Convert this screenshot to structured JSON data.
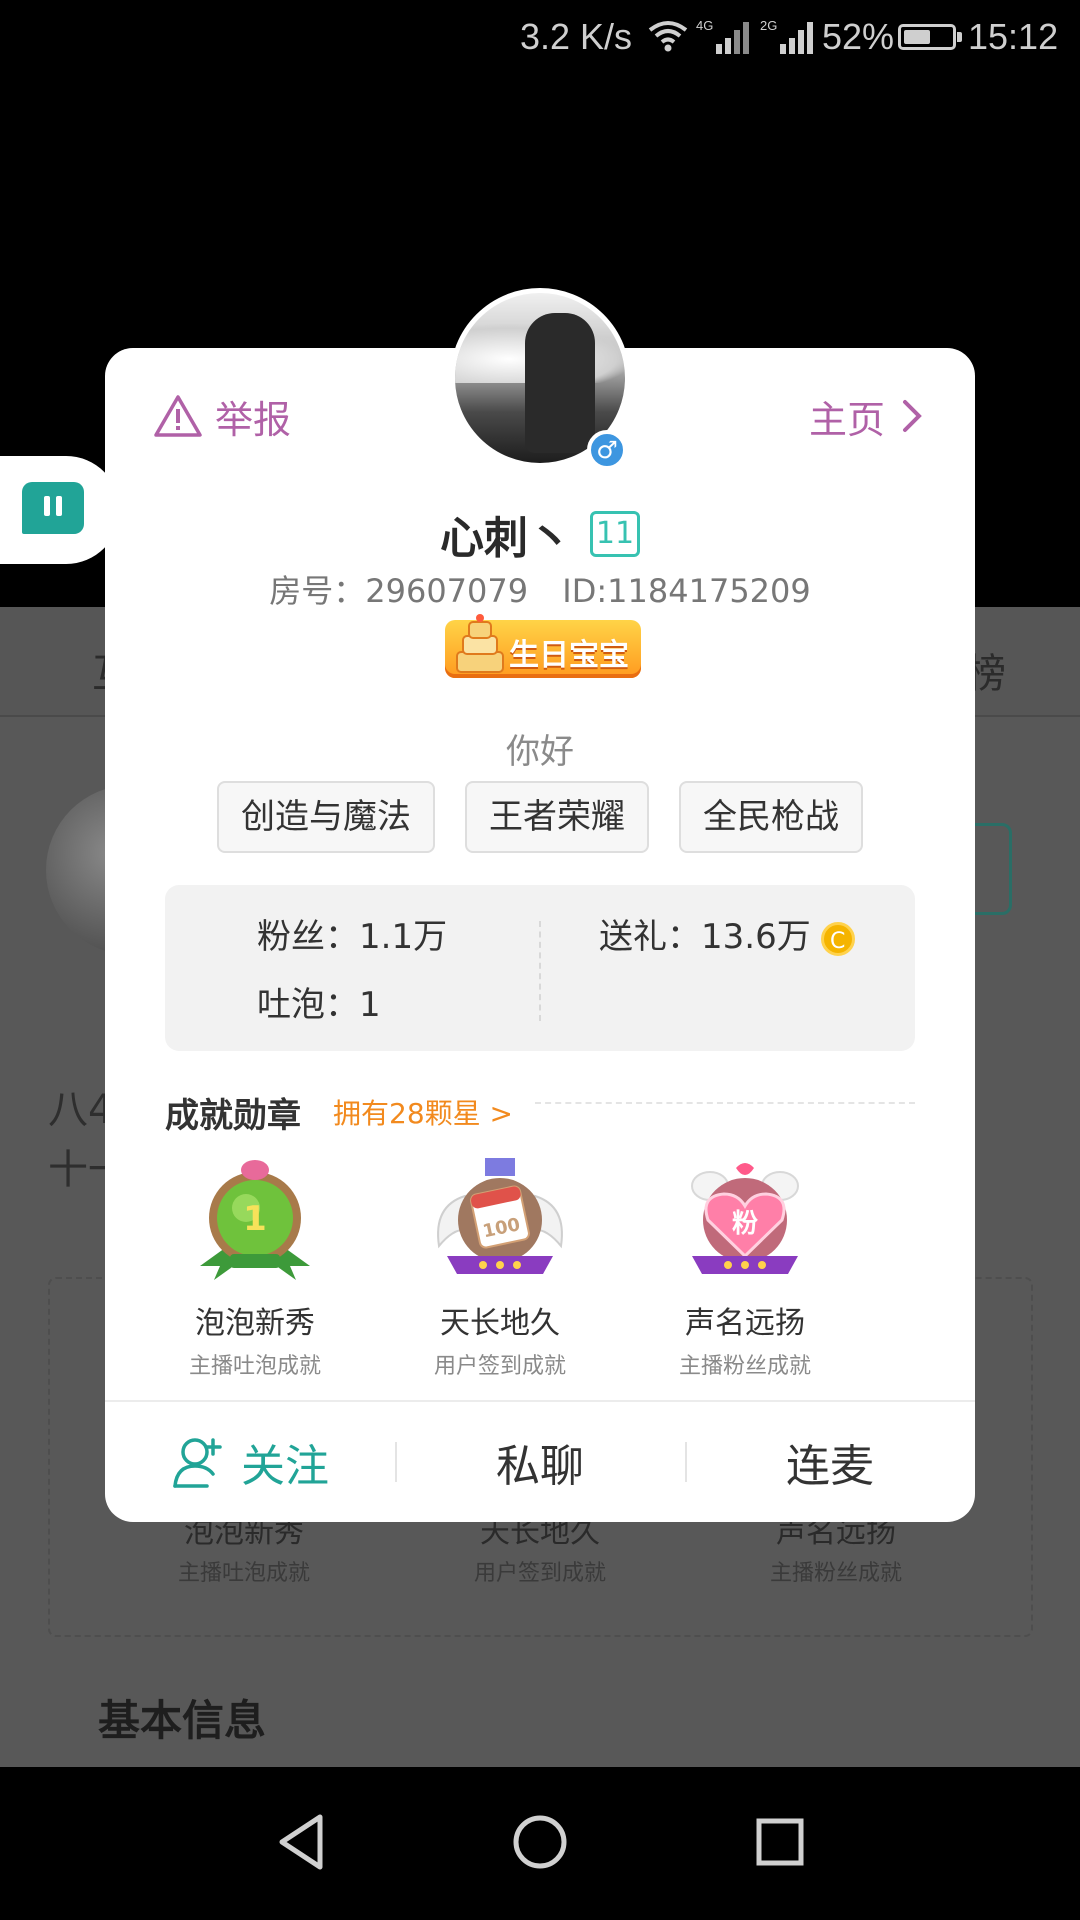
{
  "status_bar": {
    "net_speed": "3.2 K/s",
    "signal_1_label": "4G",
    "signal_2_label": "2G",
    "battery": "52%",
    "time": "15:12"
  },
  "background": {
    "tab_left": "互",
    "tab_right": "榜",
    "text_line_1": "八4",
    "text_line_2": "十一",
    "medals": [
      {
        "title": "泡泡新秀",
        "subtitle": "主播吐泡成就"
      },
      {
        "title": "天长地久",
        "subtitle": "用户签到成就"
      },
      {
        "title": "声名远扬",
        "subtitle": "主播粉丝成就"
      }
    ],
    "basic_info_heading": "基本信息"
  },
  "card": {
    "report_label": "举报",
    "homepage_label": "主页",
    "gender_symbol": "♂",
    "name": "心刺丶",
    "level": "11",
    "room_number": "房号：29607079",
    "user_id": "ID:1184175209",
    "badge_text": "生日宝宝",
    "greeting": "你好",
    "tags": [
      "创造与魔法",
      "王者荣耀",
      "全民枪战"
    ],
    "stats": {
      "fans": "粉丝：1.1万",
      "gifts": "送礼：13.6万",
      "bubbles": "吐泡：1",
      "coin_glyph": "C"
    },
    "achievements": {
      "title": "成就勋章",
      "stars_link": "拥有28颗星 >",
      "medals": [
        {
          "title": "泡泡新秀",
          "subtitle": "主播吐泡成就",
          "icon": "green-medal-icon"
        },
        {
          "title": "天长地久",
          "subtitle": "用户签到成就",
          "icon": "calendar-wings-medal-icon"
        },
        {
          "title": "声名远扬",
          "subtitle": "主播粉丝成就",
          "icon": "pink-heart-medal-icon"
        }
      ]
    },
    "actions": {
      "follow": "关注",
      "message": "私聊",
      "connect_mic": "连麦"
    }
  },
  "colors": {
    "accent_teal": "#21a497",
    "purple_link": "#b061a7",
    "orange_link": "#f28a1e"
  }
}
